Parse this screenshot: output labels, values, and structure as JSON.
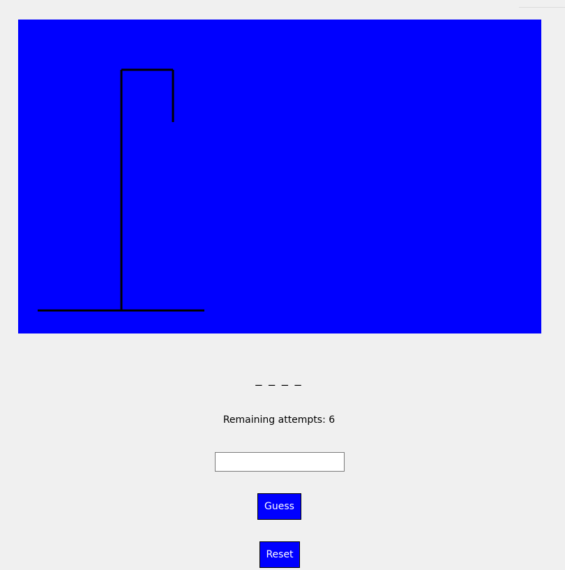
{
  "game": {
    "masked_word": "_ _ _ _",
    "attempts_label": "Remaining attempts: 6",
    "remaining_attempts": 6,
    "hangman_stage": 0
  },
  "controls": {
    "guess_input_value": "",
    "guess_button_label": "Guess",
    "reset_button_label": "Reset"
  },
  "colors": {
    "canvas_background": "#0000ff",
    "gallows_stroke": "#000000",
    "window_background": "#f0f0f0",
    "button_background": "#0000ff",
    "button_text": "#ffffff"
  }
}
